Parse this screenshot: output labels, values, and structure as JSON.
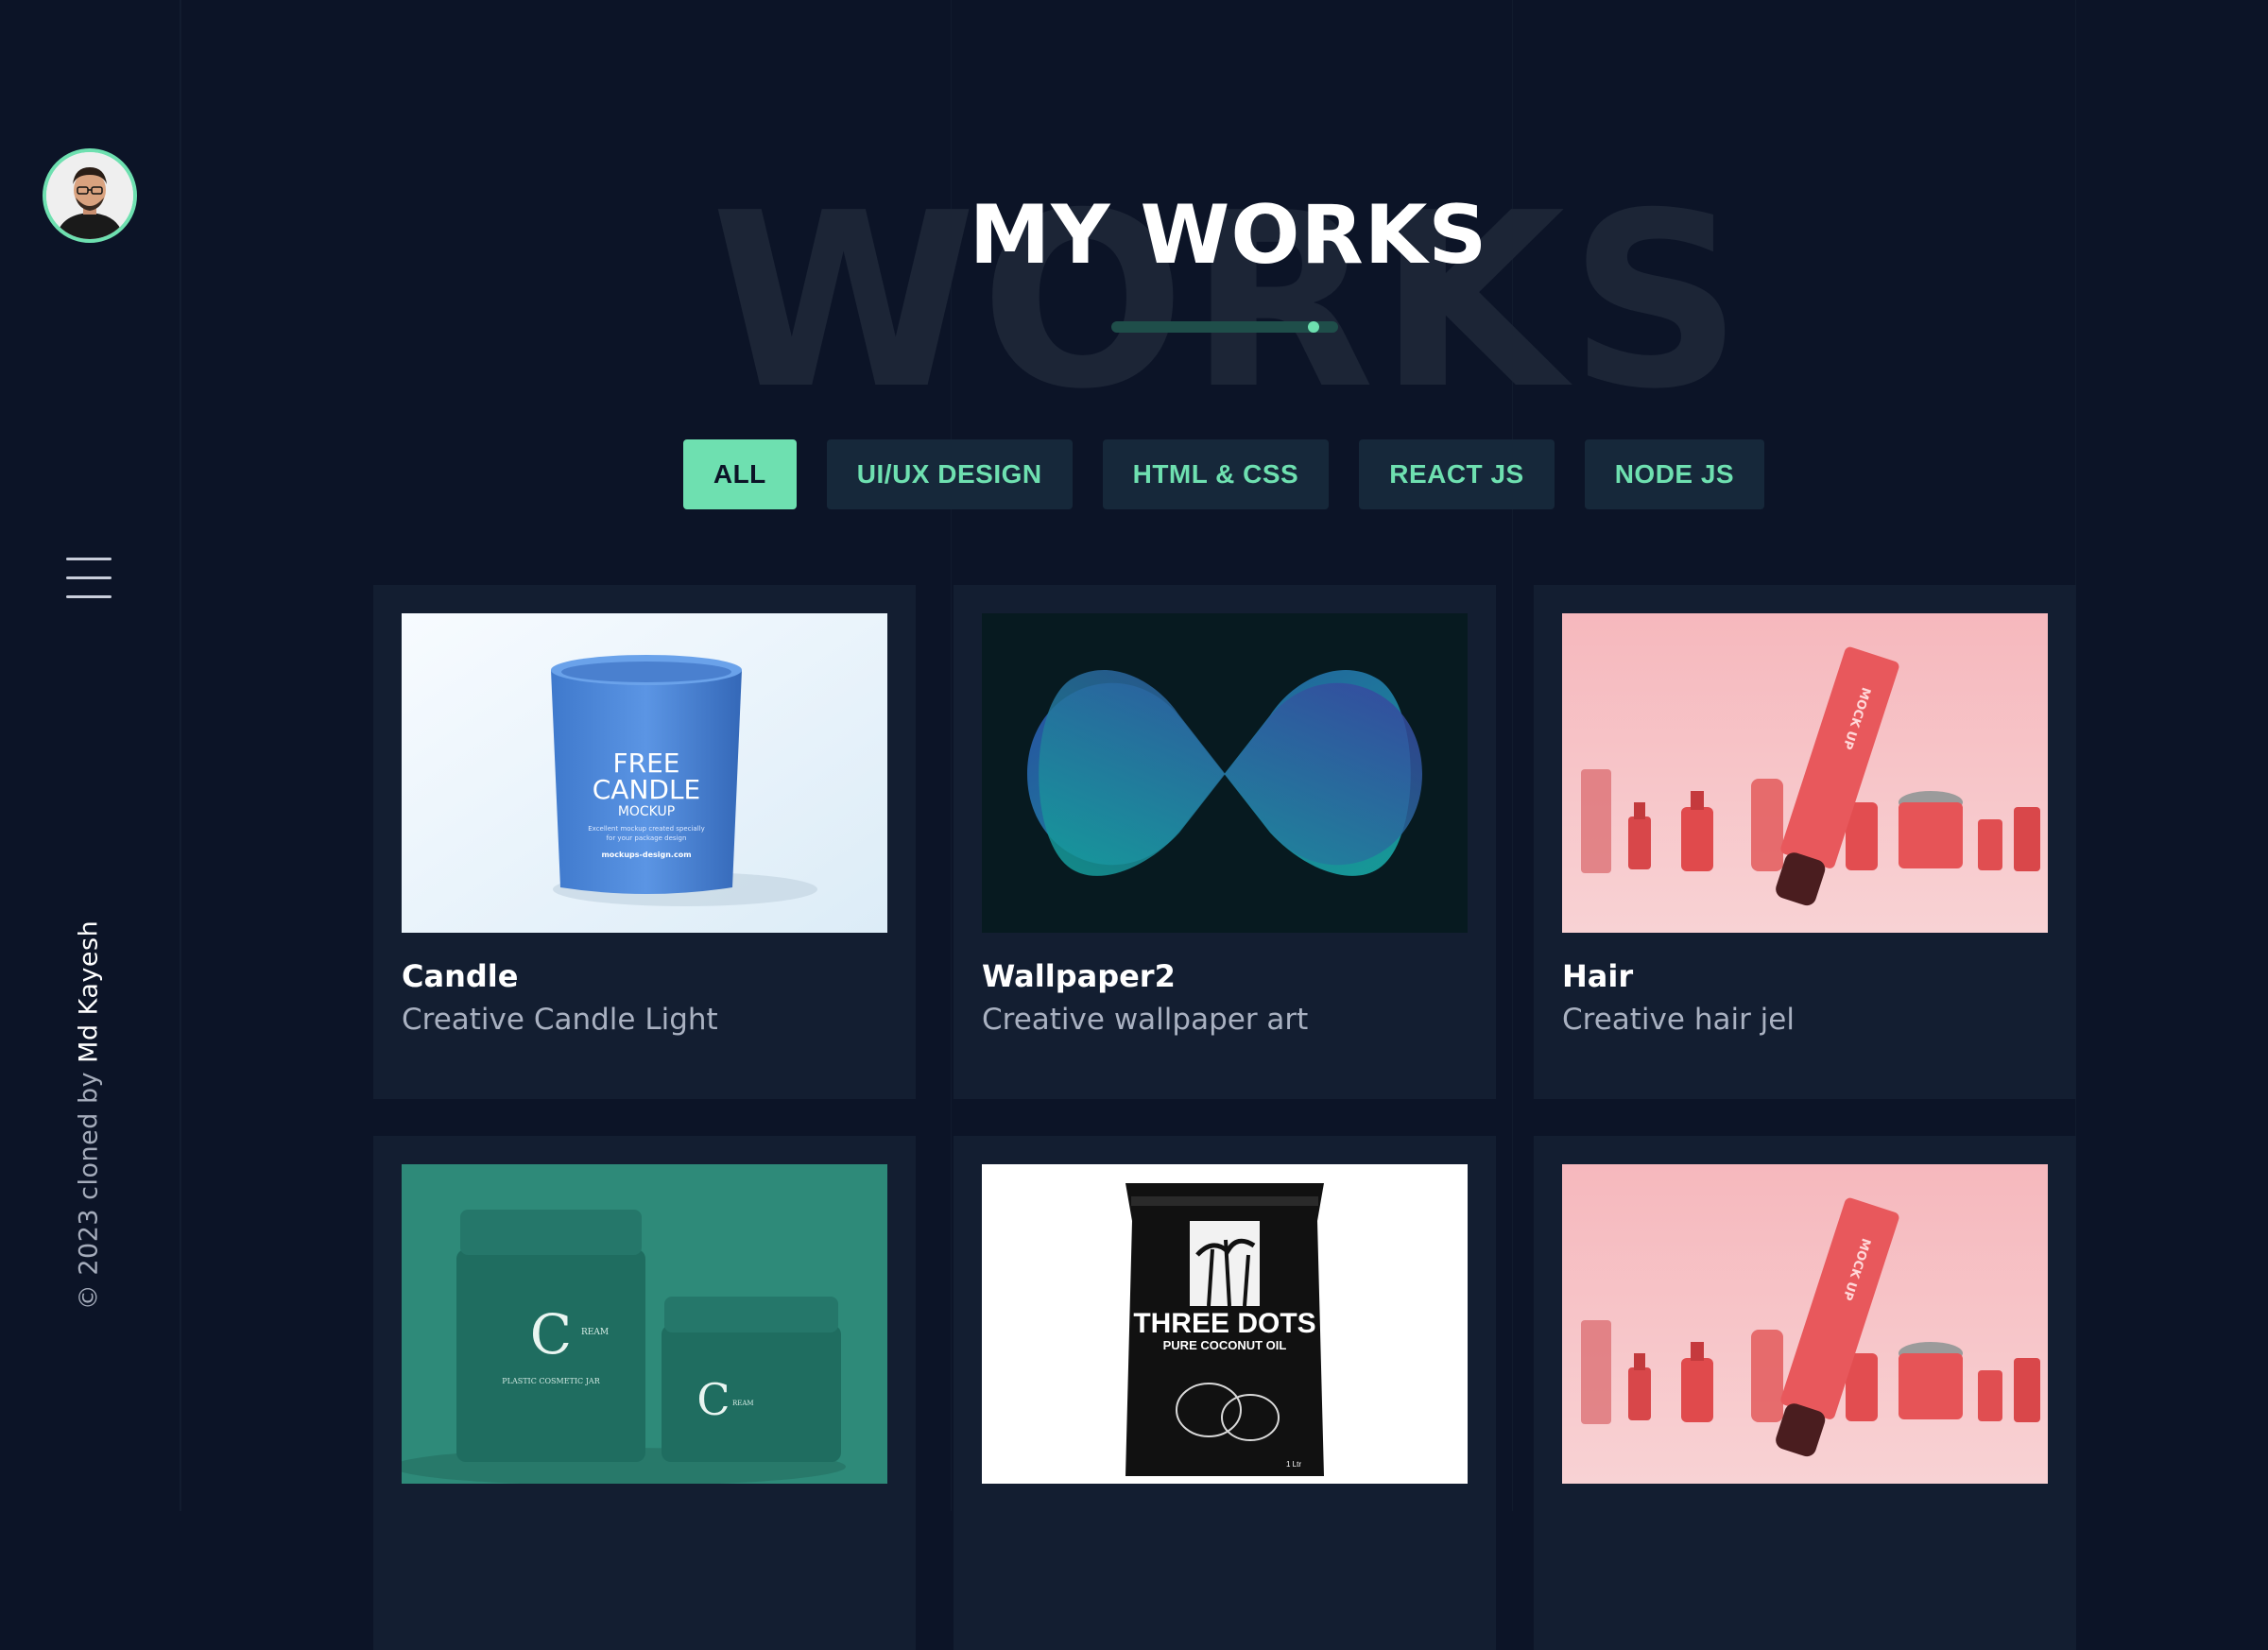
{
  "sidebar": {
    "credit_prefix": "© 2023 cloned by ",
    "credit_author": "Md Kayesh"
  },
  "section": {
    "background_word": "WORKS",
    "title": "MY WORKS"
  },
  "filters": [
    {
      "label": "ALL",
      "active": true
    },
    {
      "label": "UI/UX DESIGN",
      "active": false
    },
    {
      "label": "HTML & CSS",
      "active": false
    },
    {
      "label": "REACT JS",
      "active": false
    },
    {
      "label": "NODE JS",
      "active": false
    }
  ],
  "works": [
    {
      "title": "Candle",
      "subtitle": "Creative Candle Light",
      "image": "blue candle jar mockup",
      "image_text": {
        "line1": "FREE",
        "line2": "CANDLE",
        "line3": "MOCKUP",
        "small1": "Excellent mockup created specially",
        "small2": "for your package design",
        "site": "mockups-design.com"
      }
    },
    {
      "title": "Wallpaper2",
      "subtitle": "Creative wallpaper art",
      "image": "gradient infinity wallpaper"
    },
    {
      "title": "Hair",
      "subtitle": "Creative hair jel",
      "image": "pink cosmetic tube mockup",
      "image_text": {
        "tube": "MOCK UP"
      }
    },
    {
      "title": "",
      "subtitle": "",
      "image": "green cream jars mockup",
      "image_text": {
        "logo": "C",
        "brand": "REAM",
        "line": "PLASTIC COSMETIC JAR"
      }
    },
    {
      "title": "",
      "subtitle": "",
      "image": "coconut oil pouch mockup",
      "image_text": {
        "brand": "THREE DOTS",
        "product": "PURE COCONUT OIL",
        "volume": "1 Ltr"
      }
    },
    {
      "title": "",
      "subtitle": "",
      "image": "pink cosmetic tube mockup",
      "image_text": {
        "tube": "MOCK UP"
      }
    }
  ],
  "colors": {
    "accent": "#6ee0b0",
    "background": "#0c1427",
    "card": "#131e31"
  }
}
